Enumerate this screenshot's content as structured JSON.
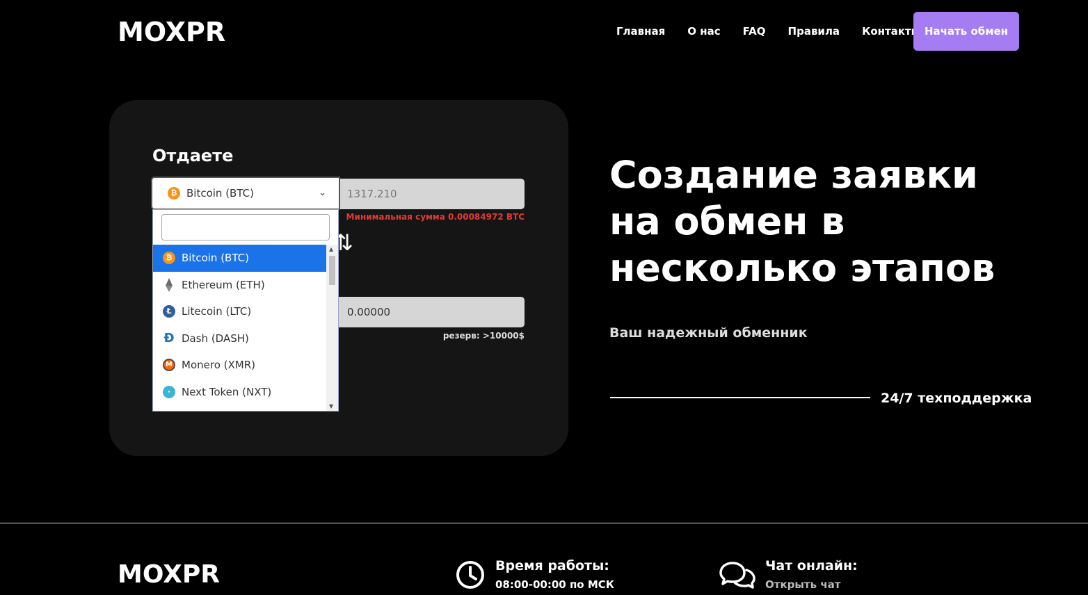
{
  "header": {
    "logo": "MOXPR",
    "nav": [
      "Главная",
      "О нас",
      "FAQ",
      "Правила",
      "Контакты"
    ],
    "cta": "Начать обмен"
  },
  "exchange": {
    "give_label": "Отдаете",
    "selected_currency": "Bitcoin (BTC)",
    "give_amount": "1317.210",
    "min_amount_note": "Минимальная сумма 0.00084972 BTC",
    "swap_icon": "swap-arrows-icon",
    "get_amount": "0.00000",
    "reserve_note": "резерв: >10000$",
    "dropdown": {
      "search_value": "",
      "options": [
        {
          "label": "Bitcoin (BTC)",
          "icon": "btc",
          "active": true
        },
        {
          "label": "Ethereum (ETH)",
          "icon": "eth",
          "active": false
        },
        {
          "label": "Litecoin (LTC)",
          "icon": "ltc",
          "active": false
        },
        {
          "label": "Dash (DASH)",
          "icon": "dash",
          "active": false
        },
        {
          "label": "Monero (XMR)",
          "icon": "xmr",
          "active": false
        },
        {
          "label": "Next Token (NXT)",
          "icon": "nxt",
          "active": false
        }
      ]
    }
  },
  "hero": {
    "title": "Создание заявки на обмен в несколько этапов",
    "subtitle": "Ваш надежный обменник",
    "support": "24/7 техподдержка"
  },
  "footer": {
    "logo": "MOXPR",
    "hours_title": "Время работы:",
    "hours_value": "08:00-00:00 по МСК",
    "chat_title": "Чат онлайн:",
    "chat_link": "Открыть чат"
  }
}
